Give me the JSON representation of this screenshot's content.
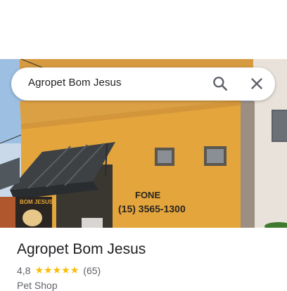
{
  "search": {
    "query": "Agropet Bom Jesus"
  },
  "icons": {
    "search": "search-icon",
    "close": "close-icon"
  },
  "photo": {
    "sign_line1": "FONE",
    "sign_line2": "(15) 3565-1300",
    "shop_sign": "BOM JESUS"
  },
  "place": {
    "title": "Agropet Bom Jesus",
    "rating": "4,8",
    "rating_stars": 5,
    "review_count": "(65)",
    "category": "Pet Shop"
  },
  "colors": {
    "star": "#fbbc04",
    "wall": "#e2a83f",
    "sky": "#8fb4da"
  }
}
